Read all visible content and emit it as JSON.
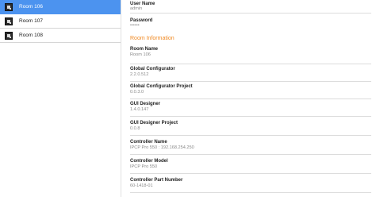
{
  "sidebar": {
    "rooms": [
      {
        "label": "Room 106",
        "selected": true
      },
      {
        "label": "Room 107",
        "selected": false
      },
      {
        "label": "Room 108",
        "selected": false
      }
    ]
  },
  "credentials": {
    "user_name_label": "User Name",
    "user_name_value": "admin",
    "password_label": "Password",
    "password_value": "••••••"
  },
  "room_info": {
    "title": "Room Information",
    "fields": [
      {
        "label": "Room Name",
        "value": "Room 106"
      },
      {
        "label": "Global Configurator",
        "value": "2.2.0.512"
      },
      {
        "label": "Global Configurator Project",
        "value": "0.0.3.0"
      },
      {
        "label": "GUI Designer",
        "value": "1.4.0.147"
      },
      {
        "label": "GUI Designer Project",
        "value": "0.0.8"
      },
      {
        "label": "Controller Name",
        "value": "IPCP Pro 550 : 192.168.254.250"
      },
      {
        "label": "Controller Model",
        "value": "IPCP Pro 550"
      },
      {
        "label": "Controller Part Number",
        "value": "60-1418-01"
      }
    ]
  },
  "colors": {
    "accent": "#4c93ef",
    "section_title": "#f08a24",
    "divider": "#dcdcdc"
  }
}
